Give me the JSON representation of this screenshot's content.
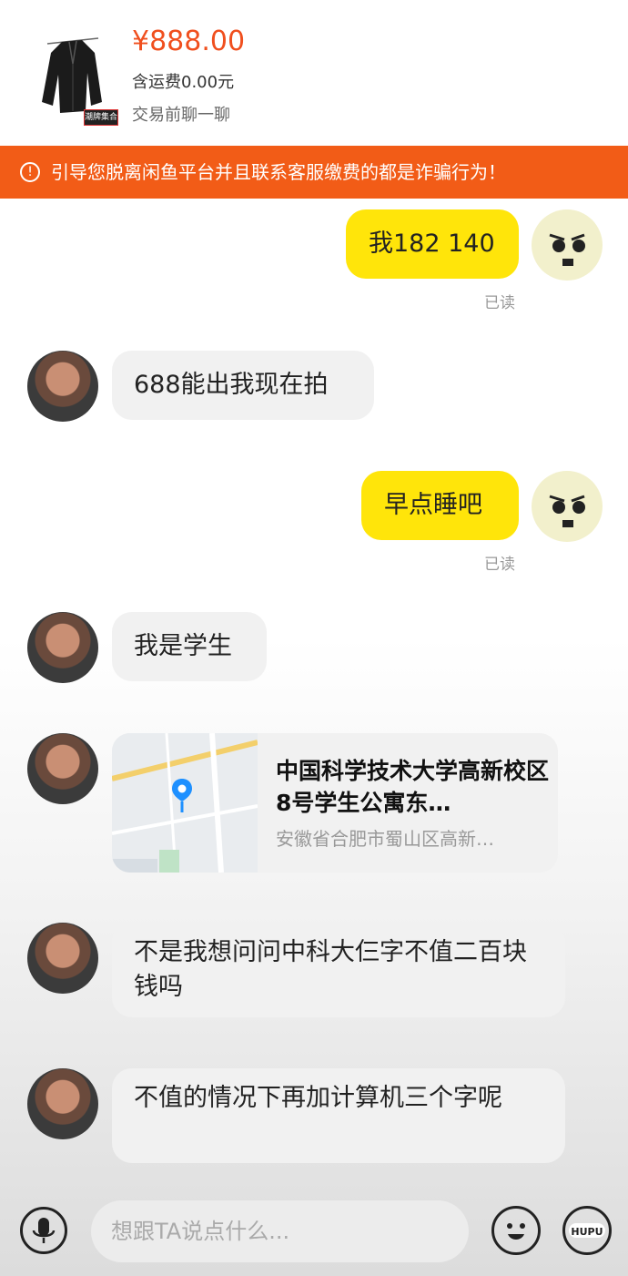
{
  "product": {
    "price": "¥888.00",
    "shipping": "含运费0.00元",
    "chat_prompt": "交易前聊一聊",
    "thumb_badge": "潮牌集合"
  },
  "warning": {
    "icon": "!",
    "text": "引导您脱离闲鱼平台并且联系客服缴费的都是诈骗行为！"
  },
  "messages": [
    {
      "sender": "self",
      "text": "我182 140",
      "status": "已读"
    },
    {
      "sender": "other",
      "text": "688能出我现在拍"
    },
    {
      "sender": "self",
      "text": "早点睡吧",
      "status": "已读"
    },
    {
      "sender": "other",
      "text": "我是学生"
    },
    {
      "sender": "other",
      "type": "location",
      "title": "中国科学技术大学高新校区8号学生公寓东…",
      "address": "安徽省合肥市蜀山区高新…"
    },
    {
      "sender": "other",
      "text": "不是我想问问中科大仨字不值二百块钱吗"
    },
    {
      "sender": "other",
      "text": "不值的情况下再加计算机三个字呢"
    }
  ],
  "input": {
    "placeholder": "想跟TA说点什么..."
  },
  "watermark": "HUPU",
  "colors": {
    "accent": "#f04f1e",
    "warning_bg": "#f25c17",
    "self_bubble": "#ffe50a",
    "other_bubble": "#f1f1f1"
  }
}
